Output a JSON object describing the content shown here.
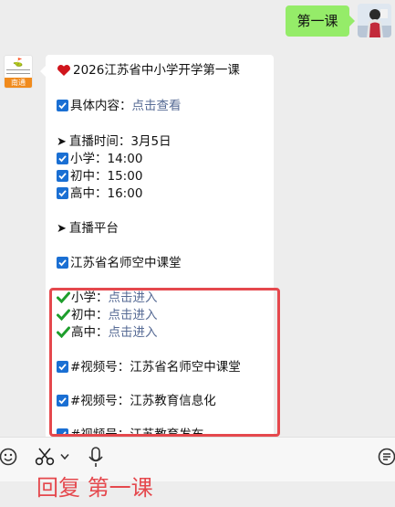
{
  "chat": {
    "outgoing_message": "第一课",
    "avatar_logo": "南通",
    "lines": {
      "title": "2026江苏省中小学开学第一课",
      "content_label": "具体内容：",
      "content_link": "点击查看",
      "live_time": "直播时间：3月5日",
      "primary_time": "小学：14:00",
      "junior_time": "初中：15:00",
      "senior_time": "高中：16:00",
      "platform": "直播平台",
      "platform_name": "江苏省名师空中课堂",
      "primary_label": "小学：",
      "junior_label": "初中：",
      "senior_label": "高中：",
      "enter_link": "点击进入",
      "channel1": "#视频号：江苏省名师空中课堂",
      "channel2": "#视频号：江苏教育信息化",
      "channel3": "#视频号：江苏教育发布"
    }
  },
  "colors": {
    "outgoing_bubble": "#95ec69",
    "link": "#576b95",
    "highlight": "#e5484d",
    "checkbox": "#1a6fd3"
  },
  "input_bar": {
    "icons": [
      "emoji-icon",
      "scissors-icon",
      "chevron-down-icon",
      "microphone-icon",
      "message-icon"
    ]
  },
  "caption": "回复 第一课"
}
